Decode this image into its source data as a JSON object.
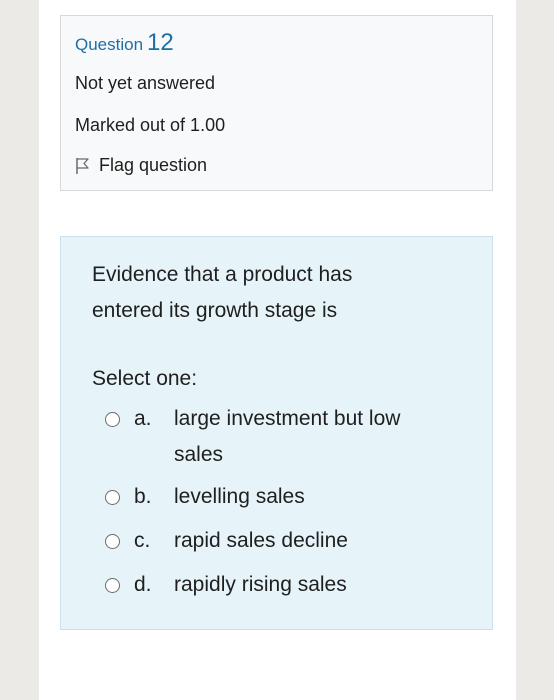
{
  "question_info": {
    "label": "Question",
    "number": "12",
    "status": "Not yet answered",
    "marks": "Marked out of 1.00",
    "flag_label": "Flag question"
  },
  "question": {
    "text": "Evidence that a product has entered its growth stage is",
    "prompt": "Select one:",
    "answers": [
      {
        "letter": "a.",
        "text": "large investment but low sales"
      },
      {
        "letter": "b.",
        "text": "levelling sales"
      },
      {
        "letter": "c.",
        "text": "rapid sales decline"
      },
      {
        "letter": "d.",
        "text": "rapidly rising sales"
      }
    ]
  },
  "colors": {
    "question_title": "#1d6fa8",
    "info_background": "#f8f9fa",
    "content_background": "#e6f3f8",
    "page_background": "#eceae6"
  },
  "icons": {
    "flag": "flag-icon",
    "radio": "radio-button-icon"
  }
}
